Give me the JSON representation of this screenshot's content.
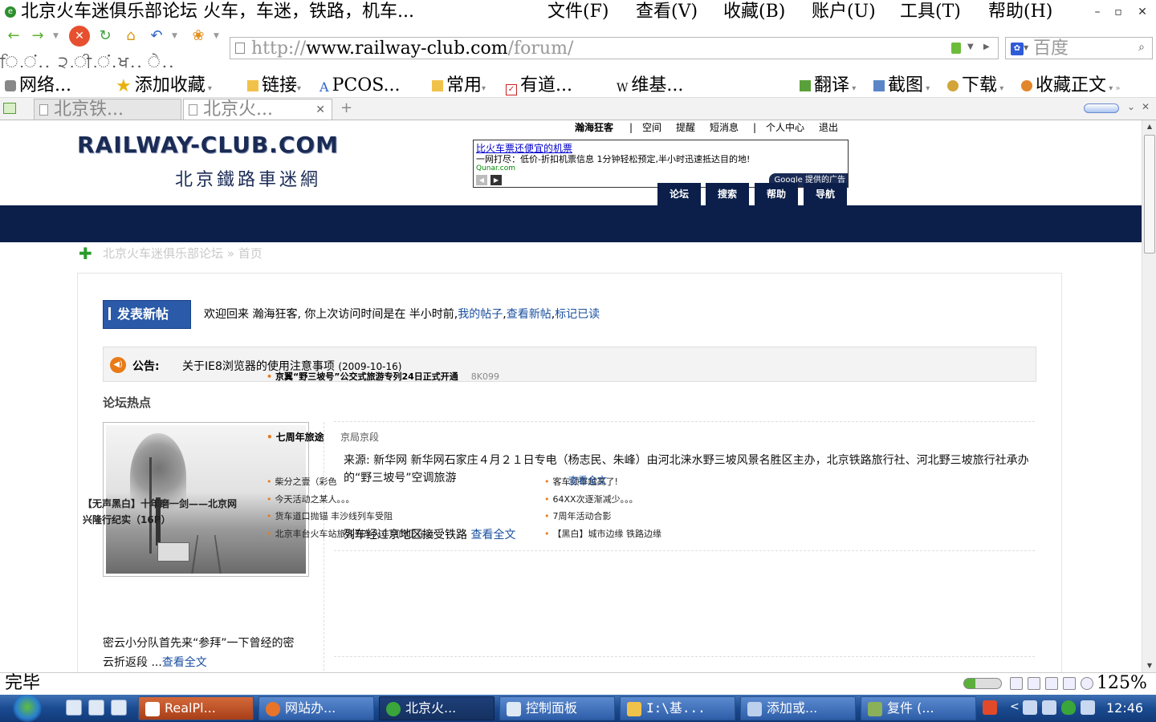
{
  "window": {
    "title": "北京火车迷俱乐部论坛  火车，车迷，铁路，机车...",
    "menu": [
      "文件(F)",
      "查看(V)",
      "收藏(B)",
      "账户(U)",
      "工具(T)",
      "帮助(H)"
    ],
    "controls": [
      "–",
      "▫",
      "✕"
    ]
  },
  "toolbar": {
    "back": "←",
    "forward": "→",
    "stop": "✕",
    "refresh": "↻",
    "home": "⌂",
    "undo": "↶",
    "paw": "❀",
    "url_prefix": "http://",
    "url_host": "www.railway-club.com",
    "url_path": "/forum/",
    "search_placeholder": "百度",
    "garbled_row": "ਿ.ਂ.. ੨.ੀ.ਂ.ਖ.. ੇ.."
  },
  "favorites": [
    {
      "label": "网络...",
      "icon": "lock-icon"
    },
    {
      "label": "添加收藏",
      "icon": "star-icon"
    },
    {
      "label": "链接",
      "icon": "folder-icon"
    },
    {
      "label": "PCOS...",
      "icon": "a-icon"
    },
    {
      "label": "常用",
      "icon": "folder-icon"
    },
    {
      "label": "有道...",
      "icon": "check-icon"
    },
    {
      "label": "维基...",
      "icon": "w-icon"
    },
    {
      "label": "翻译",
      "icon": "translate-icon"
    },
    {
      "label": "截图",
      "icon": "screenshot-icon"
    },
    {
      "label": "下载",
      "icon": "download-icon"
    },
    {
      "label": "收藏正文",
      "icon": "bookmark-icon"
    }
  ],
  "tabs": [
    {
      "label": "北京铁...",
      "active": false
    },
    {
      "label": "北京火...",
      "active": true
    }
  ],
  "site": {
    "logo": "RAILWAY-CLUB.COM",
    "subtitle": "北京鐵路車迷網",
    "user_links": [
      "瀚海狂客",
      "|",
      "空间",
      "提醒",
      "短消息",
      "|",
      "个人中心",
      "退出"
    ],
    "nav": [
      "论坛",
      "搜索",
      "帮助",
      "导航"
    ],
    "ad": {
      "title": "比火车票还便宜的机票",
      "text": "一网打尽：低价-折扣机票信息 1分钟轻松预定,半小时迅速抵达目的地!",
      "url": "Qunar.com",
      "prev": "◀",
      "next": "▶",
      "badge": "Google 提供的广告"
    },
    "breadcrumb_plus": "✚",
    "breadcrumb": "北京火车迷俱乐部论坛 » 首页",
    "post_button": "发表新帖",
    "welcome_text": "欢迎回来 瀚海狂客, 你上次访问时间是在 半小时前,",
    "welcome_links": [
      "我的帖子",
      "查看新帖",
      "标记已读"
    ],
    "notice_label": "公告:",
    "notice_text": "关于IE8浏览器的使用注意事项",
    "notice_date": "(2009-10-16)",
    "hot_overlay_title": "京翼“野三坡号”公交式旅游专列24日正式开通",
    "hot_overlay_tag": "8K099",
    "hot_title": "论坛热点",
    "photo_caption": "【无声黑白】十年磨一剑——北京网兴隆行纪实（16P）",
    "news_tag": "京局京段",
    "news_tag_overlay": "七周年旅途",
    "article1": "来源: 新华网      新华网石家庄４月２１日专电（杨志民、朱峰）由河北涞水野三坡风景名胜区主办，北京铁路旅行社、河北野三坡旅行社承办的“野三坡号”空调旅游",
    "article1_end": "列车经过京地区接受铁路",
    "article1_more": "查看全文",
    "list_left": [
      "柴分之壹（彩色",
      "今天活动之某人。。。",
      "货车道口抛锚 丰沙线列车受阻",
      "北京丰台火车站旅客列车火车站的正在运"
    ],
    "list_right": [
      "客车频率越高了!",
      "64XX次逐渐减少。。。",
      "7周年活动合影",
      "【黑白】城市边缘 铁路边缘"
    ],
    "list_right_overlay": "查看全文",
    "left_text": "密云小分队首先来“参拜”一下曾经的密云折返段 ...",
    "left_text_more": "查看全文"
  },
  "statusbar": {
    "status": "完毕",
    "zoom": "125%"
  },
  "taskbar": {
    "items": [
      {
        "label": "RealPl...",
        "active": false,
        "hot": true
      },
      {
        "label": "网站办...",
        "active": false,
        "hot": false
      },
      {
        "label": "北京火...",
        "active": true,
        "hot": false
      },
      {
        "label": "控制面板",
        "active": false,
        "hot": false
      },
      {
        "label": "I:\\基...",
        "active": false,
        "hot": false
      },
      {
        "label": "添加或...",
        "active": false,
        "hot": false
      },
      {
        "label": "复件 (...",
        "active": false,
        "hot": false
      }
    ],
    "clock": "12:46",
    "tray_arrow": "<"
  }
}
